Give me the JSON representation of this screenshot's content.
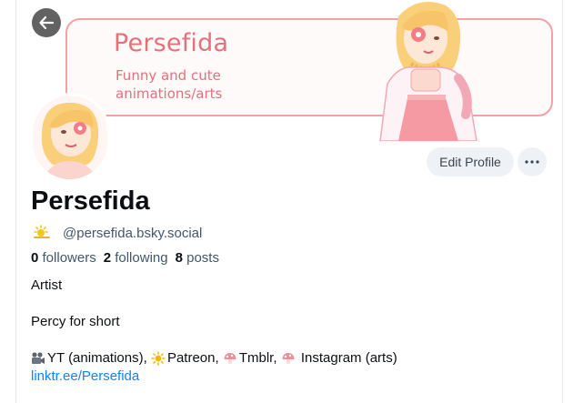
{
  "banner": {
    "name": "Persefida",
    "tagline_line1": "Funny and cute",
    "tagline_line2": "animations/arts"
  },
  "header": {
    "back_icon": "arrow-left-icon"
  },
  "actions": {
    "edit_label": "Edit Profile",
    "more_icon": "ellipsis-icon"
  },
  "profile": {
    "display_name": "Persefida",
    "handle_emoji": "sun-cloud-icon",
    "handle": "@persefida.bsky.social",
    "followers_count": "0",
    "followers_label": "followers",
    "following_count": "2",
    "following_label": "following",
    "posts_count": "8",
    "posts_label": "posts"
  },
  "bio": {
    "line1": "Artist",
    "line2": "Percy for short",
    "links": {
      "yt": "YT (animations),",
      "patreon": "Patreon,",
      "tmblr": "Tmblr,",
      "instagram": "Instagram (arts)"
    },
    "link_url": "linktr.ee/Persefida"
  },
  "colors": {
    "accent_pink": "#e4707a",
    "link_blue": "#1083fe",
    "muted_text": "#42576c",
    "button_bg": "#eef2f6"
  }
}
